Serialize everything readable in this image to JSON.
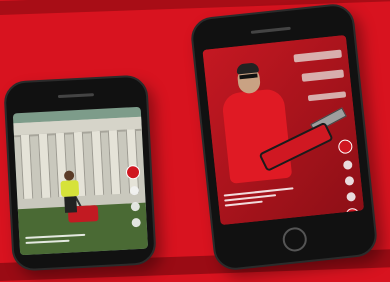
{
  "scene": {
    "background": "#d8131f",
    "accent_dark": "#a80d16"
  },
  "phone_left": {
    "screen_subject": "garden-mowing-video",
    "icons": [
      "avatar-icon",
      "heart-icon",
      "comment-icon",
      "share-icon"
    ]
  },
  "phone_right": {
    "screen_subject": "chainsaw-demo-video",
    "icons": [
      "avatar-icon",
      "heart-icon",
      "comment-icon",
      "share-icon",
      "music-disc-icon"
    ]
  }
}
